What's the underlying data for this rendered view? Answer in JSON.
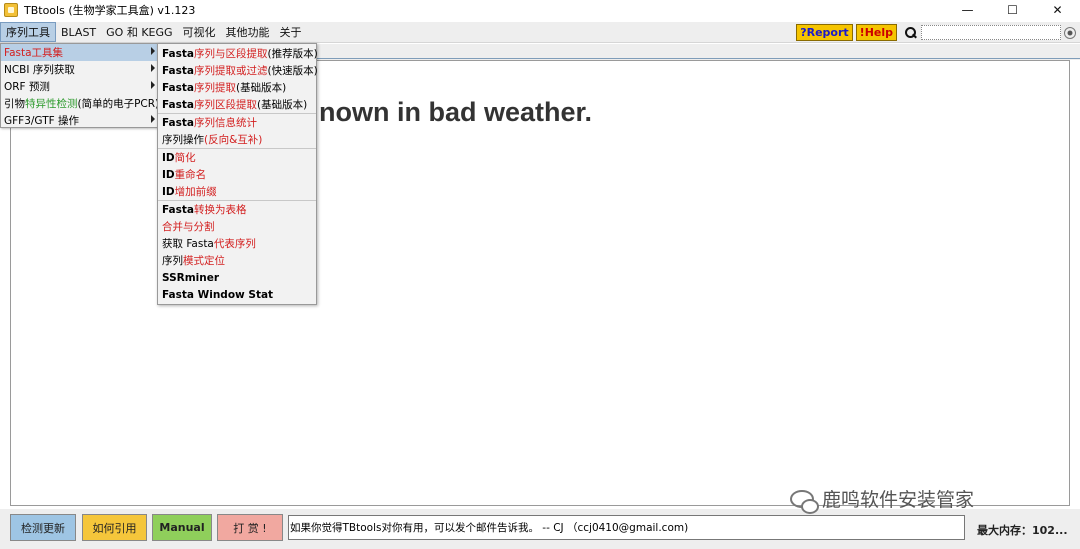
{
  "window": {
    "title": "TBtools (生物学家工具盒) v1.123",
    "icon": "tbtools-app-icon",
    "minimize": "—",
    "maximize": "☐",
    "close": "✕"
  },
  "menubar": {
    "items": [
      "序列工具",
      "BLAST",
      "GO 和 KEGG",
      "可视化",
      "其他功能",
      "关于"
    ],
    "report_label": "?Report",
    "help_label": "!Help",
    "search_placeholder": ""
  },
  "main": {
    "quote": "nown in bad weather."
  },
  "dropdown": {
    "items": [
      {
        "label_a": "Fasta ",
        "label_b": "工具集",
        "label_c": "",
        "has_submenu": true,
        "selected": true
      },
      {
        "label_a": "NCBI 序列获取",
        "label_b": "",
        "label_c": "",
        "has_submenu": true,
        "selected": false
      },
      {
        "label_a": "ORF 预测",
        "label_b": "",
        "label_c": "",
        "has_submenu": true,
        "selected": false
      },
      {
        "label_a": "引物",
        "label_b": "特异性检测",
        "label_c": " (简单的电子PCR)",
        "has_submenu": false,
        "selected": false
      },
      {
        "label_a": "GFF3/GTF 操作",
        "label_b": "",
        "label_c": "",
        "has_submenu": true,
        "selected": false
      }
    ]
  },
  "submenu": {
    "groups": [
      [
        {
          "a": "Fasta ",
          "b": "序列与区段提取",
          "c": "(推荐版本)"
        },
        {
          "a": "Fasta ",
          "b": "序列提取或过滤",
          "c": " (快速版本)"
        },
        {
          "a": "Fasta ",
          "b": "序列提取",
          "c": " (基础版本)"
        },
        {
          "a": "Fasta ",
          "b": "序列区段提取",
          "c": " (基础版本)"
        }
      ],
      [
        {
          "a": "Fasta ",
          "b": "序列信息统计",
          "c": ""
        },
        {
          "a": "序列操作",
          "b": "(反向&互补)",
          "c": ""
        }
      ],
      [
        {
          "a": "ID ",
          "b": "简化",
          "c": ""
        },
        {
          "a": "ID ",
          "b": "重命名",
          "c": ""
        },
        {
          "a": "ID ",
          "b": "增加前缀",
          "c": ""
        }
      ],
      [
        {
          "a": "Fasta ",
          "b": "转换为表格",
          "c": ""
        },
        {
          "a": "",
          "b": "合并与分割",
          "c": ""
        },
        {
          "a": "获取 Fasta ",
          "b": "代表序列",
          "c": ""
        },
        {
          "a": "序列",
          "b": "模式定位",
          "c": ""
        },
        {
          "a": "SSRminer",
          "b": "",
          "c": ""
        },
        {
          "a": "Fasta Window Stat",
          "b": "",
          "c": ""
        }
      ]
    ]
  },
  "bottom": {
    "update_label": "检测更新",
    "cite_label": "如何引用",
    "manual_label": "Manual",
    "donate_label": "打 赏 !",
    "status_text": "如果你觉得TBtools对你有用，可以发个邮件告诉我。 -- CJ （ccj0410@gmail.com)",
    "memory_label": "最大内存：102..."
  },
  "watermark": {
    "text": "公众号：鹿鸣软件安装管家",
    "logo_text": "鹿鸣软件安装管家"
  }
}
